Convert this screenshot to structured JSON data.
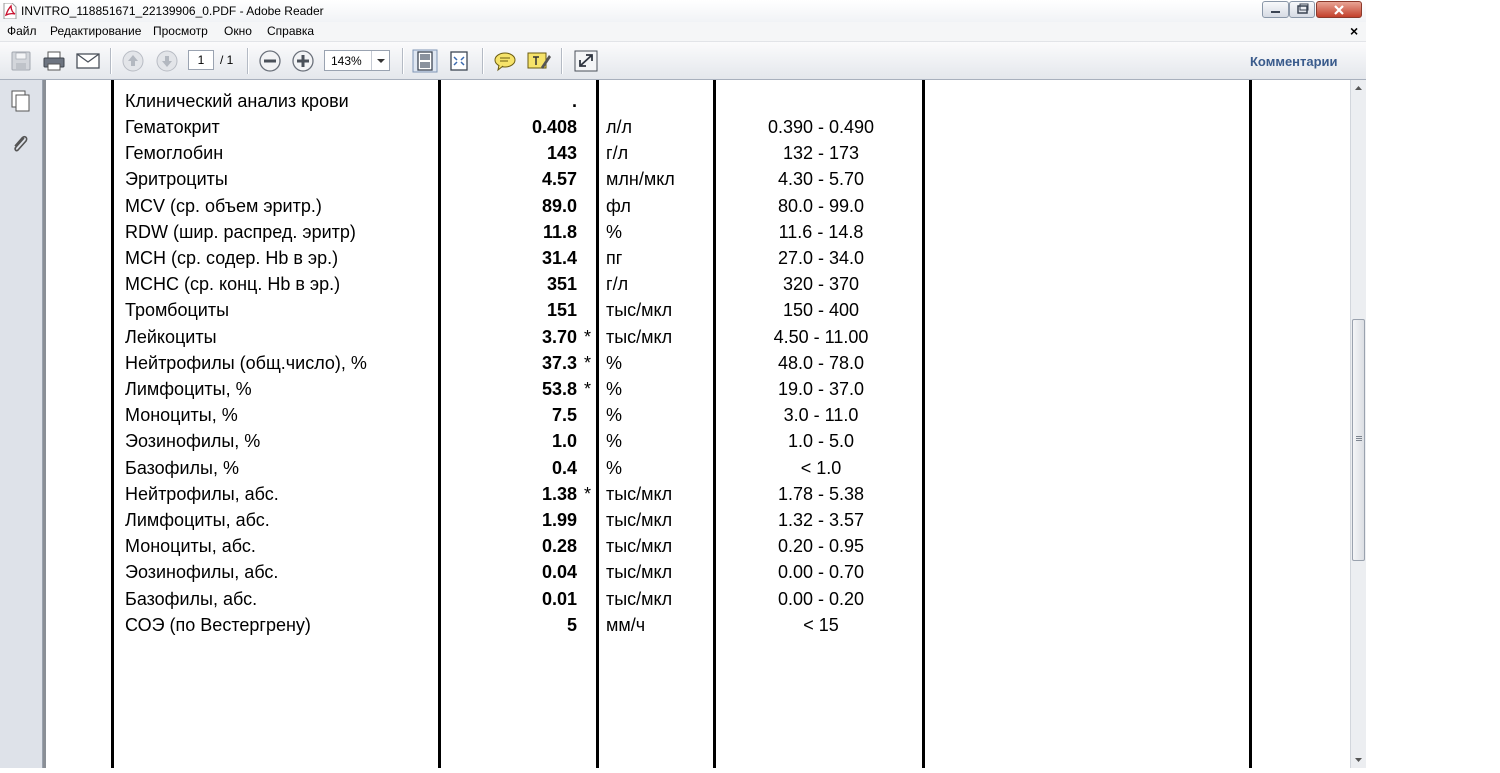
{
  "window": {
    "title": "INVITRO_118851671_22139906_0.PDF - Adobe Reader"
  },
  "menu": {
    "items": [
      "Файл",
      "Редактирование",
      "Просмотр",
      "Окно",
      "Справка"
    ],
    "close_glyph": "×"
  },
  "toolbar": {
    "current_page": "1",
    "page_total": "/ 1",
    "zoom": "143%",
    "comments_label": "Комментарии",
    "icons": [
      "save-icon",
      "print-icon",
      "email-icon",
      "prev-page-icon",
      "next-page-icon",
      "zoom-out-icon",
      "zoom-in-icon",
      "fit-page-icon",
      "fit-width-icon",
      "sticky-note-icon",
      "highlight-icon",
      "expand-icon"
    ]
  },
  "report": {
    "header_row": {
      "name": "Клинический анализ крови",
      "value": "."
    },
    "rows": [
      {
        "name": "Гематокрит",
        "value": "0.408",
        "flag": "",
        "unit": "л/л",
        "ref": "0.390 - 0.490"
      },
      {
        "name": "Гемоглобин",
        "value": "143",
        "flag": "",
        "unit": "г/л",
        "ref": "132 - 173"
      },
      {
        "name": "Эритроциты",
        "value": "4.57",
        "flag": "",
        "unit": "млн/мкл",
        "ref": "4.30 - 5.70"
      },
      {
        "name": "MCV (ср. объем эритр.)",
        "value": "89.0",
        "flag": "",
        "unit": "фл",
        "ref": "80.0 - 99.0"
      },
      {
        "name": "RDW (шир. распред. эритр)",
        "value": "11.8",
        "flag": "",
        "unit": "%",
        "ref": "11.6 - 14.8"
      },
      {
        "name": "MCH (ср. содер. Hb в эр.)",
        "value": "31.4",
        "flag": "",
        "unit": "пг",
        "ref": "27.0 - 34.0"
      },
      {
        "name": "MCHC (ср. конц. Hb в эр.)",
        "value": "351",
        "flag": "",
        "unit": "г/л",
        "ref": "320 - 370"
      },
      {
        "name": "Тромбоциты",
        "value": "151",
        "flag": "",
        "unit": "тыс/мкл",
        "ref": "150 - 400"
      },
      {
        "name": "Лейкоциты",
        "value": "3.70",
        "flag": "*",
        "unit": "тыс/мкл",
        "ref": "4.50 - 11.00"
      },
      {
        "name": "Нейтрофилы (общ.число), %",
        "value": "37.3",
        "flag": "*",
        "unit": "%",
        "ref": "48.0 - 78.0"
      },
      {
        "name": "Лимфоциты, %",
        "value": "53.8",
        "flag": "*",
        "unit": "%",
        "ref": "19.0 - 37.0"
      },
      {
        "name": "Моноциты, %",
        "value": "7.5",
        "flag": "",
        "unit": "%",
        "ref": "3.0 - 11.0"
      },
      {
        "name": "Эозинофилы, %",
        "value": "1.0",
        "flag": "",
        "unit": "%",
        "ref": "1.0 - 5.0"
      },
      {
        "name": "Базофилы, %",
        "value": "0.4",
        "flag": "",
        "unit": "%",
        "ref": "< 1.0"
      },
      {
        "name": "Нейтрофилы, абс.",
        "value": "1.38",
        "flag": "*",
        "unit": "тыс/мкл",
        "ref": "1.78 - 5.38"
      },
      {
        "name": "Лимфоциты, абс.",
        "value": "1.99",
        "flag": "",
        "unit": "тыс/мкл",
        "ref": "1.32 - 3.57"
      },
      {
        "name": "Моноциты, абс.",
        "value": "0.28",
        "flag": "",
        "unit": "тыс/мкл",
        "ref": "0.20 - 0.95"
      },
      {
        "name": "Эозинофилы, абс.",
        "value": "0.04",
        "flag": "",
        "unit": "тыс/мкл",
        "ref": "0.00 - 0.70"
      },
      {
        "name": "Базофилы, абс.",
        "value": "0.01",
        "flag": "",
        "unit": "тыс/мкл",
        "ref": "0.00 - 0.20"
      },
      {
        "name": "СОЭ (по Вестергрену)",
        "value": "5",
        "flag": "",
        "unit": "мм/ч",
        "ref": "< 15"
      }
    ]
  }
}
